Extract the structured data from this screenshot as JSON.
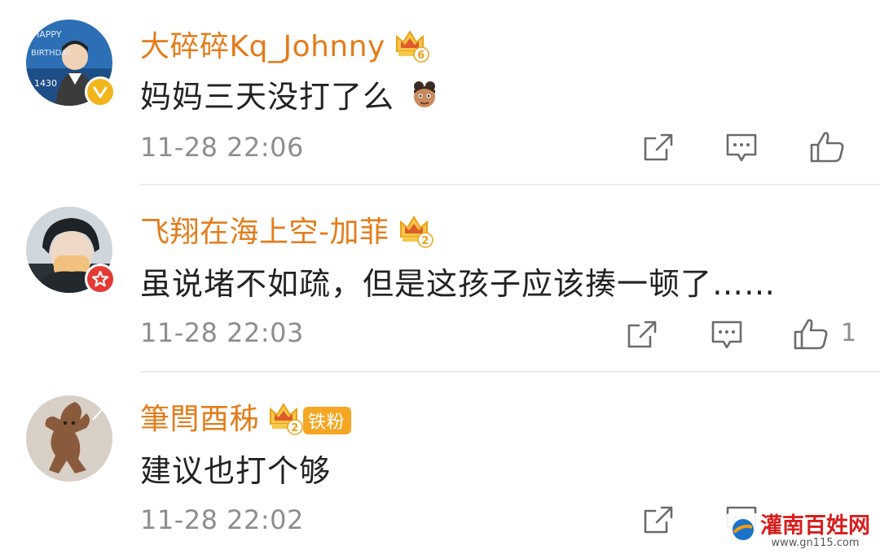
{
  "comments": [
    {
      "username": "大碎碎Kq_Johnny",
      "level": "6",
      "text": "妈妈三天没打了么",
      "time": "11-28 22:06",
      "likes": "",
      "avatar_text": [
        "HAPPY",
        "BIRTHDAY",
        "1430"
      ]
    },
    {
      "username": "飞翔在海上空-加菲",
      "level": "2",
      "text": "虽说堵不如疏，但是这孩子应该揍一顿了……",
      "time": "11-28 22:03",
      "likes": "1"
    },
    {
      "username": "筆閆酉秭",
      "level": "2",
      "fan_badge": "铁粉",
      "text": "建议也打个够",
      "time": "11-28 22:02",
      "likes": ""
    }
  ],
  "colors": {
    "username": "#e47c1b",
    "text": "#222222",
    "meta": "#8e8e8e",
    "verified_gold": "#f2b51c",
    "verified_red": "#e53935",
    "fan_badge": "#f5a623"
  },
  "watermark": {
    "title": "灌南百姓网",
    "url": "www.gn115.com"
  }
}
